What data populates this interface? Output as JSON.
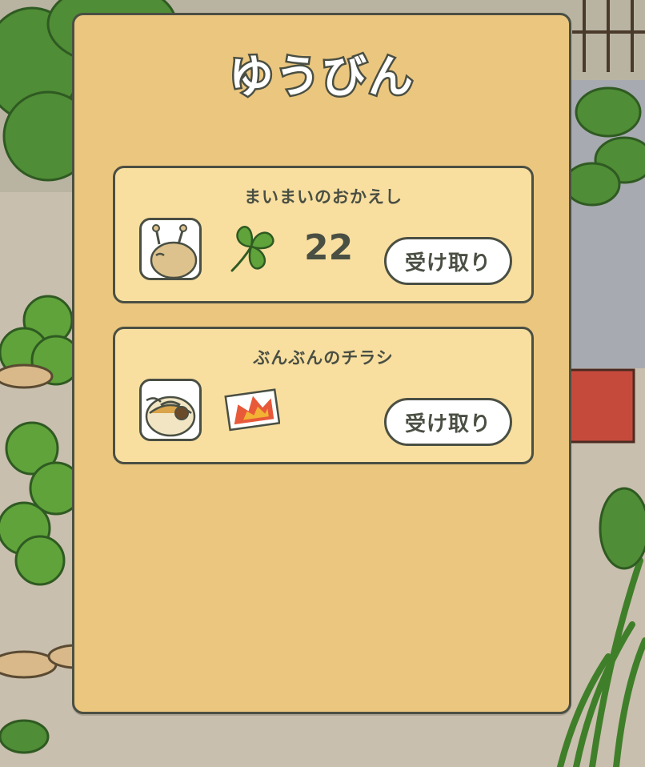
{
  "dialog": {
    "title": "ゆうびん"
  },
  "mail_items": [
    {
      "sender": "まいまいのおかえし",
      "character_icon": "snail-friend-avatar",
      "item_icon": "clover-icon",
      "count": "22",
      "button_label": "受け取り"
    },
    {
      "sender": "ぶんぶんのチラシ",
      "character_icon": "bee-friend-avatar",
      "item_icon": "flyer-icon",
      "count": "",
      "button_label": "受け取り"
    }
  ],
  "colors": {
    "panel": "#ebc67f",
    "card": "#f8dfa0",
    "outline": "#4a4f43",
    "button": "#ffffff",
    "clover": "#5fa33a"
  }
}
